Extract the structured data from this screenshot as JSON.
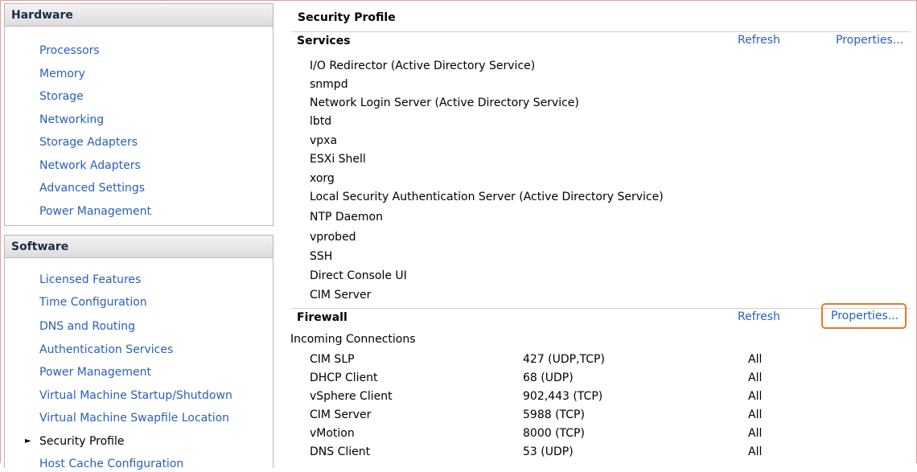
{
  "sidebar": {
    "hardware": {
      "title": "Hardware",
      "items": [
        "Processors",
        "Memory",
        "Storage",
        "Networking",
        "Storage Adapters",
        "Network Adapters",
        "Advanced Settings",
        "Power Management"
      ]
    },
    "software": {
      "title": "Software",
      "items": [
        "Licensed Features",
        "Time Configuration",
        "DNS and Routing",
        "Authentication Services",
        "Power Management",
        "Virtual Machine Startup/Shutdown",
        "Virtual Machine Swapfile Location",
        "Security Profile",
        "Host Cache Configuration"
      ],
      "current_index": 7
    }
  },
  "main": {
    "title": "Security Profile",
    "services": {
      "title": "Services",
      "refresh": "Refresh",
      "properties": "Properties...",
      "items": [
        "I/O Redirector (Active Directory Service)",
        "snmpd",
        "Network Login Server (Active Directory Service)",
        "lbtd",
        "vpxa",
        "ESXi Shell",
        "xorg",
        "Local Security Authentication Server (Active Directory Service)",
        "NTP Daemon",
        "vprobed",
        "SSH",
        "Direct Console UI",
        "CIM Server"
      ]
    },
    "firewall": {
      "title": "Firewall",
      "refresh": "Refresh",
      "properties": "Properties...",
      "subheading": "Incoming Connections",
      "rows": [
        {
          "name": "CIM SLP",
          "ports": "427 (UDP,TCP)",
          "allowed": "All"
        },
        {
          "name": "DHCP Client",
          "ports": "68 (UDP)",
          "allowed": "All"
        },
        {
          "name": "vSphere Client",
          "ports": "902,443 (TCP)",
          "allowed": "All"
        },
        {
          "name": "CIM Server",
          "ports": "5988 (TCP)",
          "allowed": "All"
        },
        {
          "name": "vMotion",
          "ports": "8000 (TCP)",
          "allowed": "All"
        },
        {
          "name": "DNS Client",
          "ports": "53 (UDP)",
          "allowed": "All"
        }
      ]
    }
  },
  "colors": {
    "link": "#2a5fb8",
    "highlight_box": "#e07a2e"
  },
  "icons": {
    "current_item_marker": "triangle-right-icon"
  }
}
